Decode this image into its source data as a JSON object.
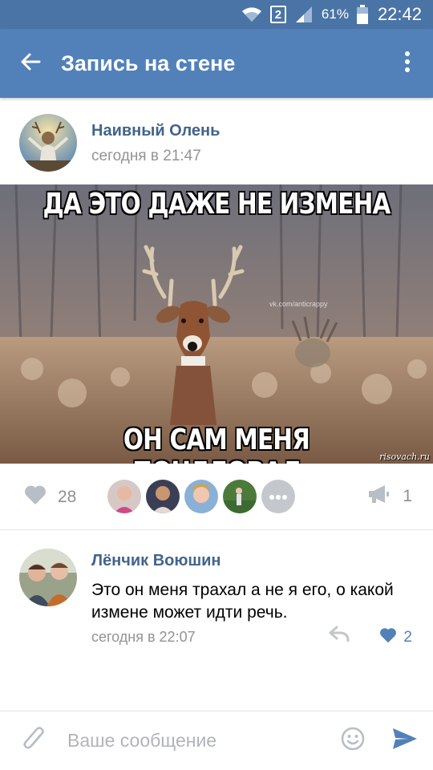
{
  "status_bar": {
    "sim_slot": "2",
    "battery": "61%",
    "time": "22:42",
    "icons": [
      "wifi-icon",
      "sim-icon",
      "signal-icon",
      "battery-icon"
    ]
  },
  "app_bar": {
    "title": "Запись на стене",
    "back_icon": "arrow-left-icon",
    "menu_icon": "more-vertical-icon",
    "color": "#5181b8"
  },
  "post": {
    "author": "Наивный Олень",
    "time": "сегодня в 21:47",
    "image": {
      "top_text": "ДА ЭТО ДАЖЕ НЕ ИЗМЕНА",
      "bottom_text": "ОН САМ МЕНЯ ПОЦЕЛОВАЛ",
      "watermark": "risovach.ru",
      "source_mark": "vk.com/anticrappy"
    },
    "likes": "28",
    "shares": "1",
    "likers_more_icon": "more-horizontal-icon"
  },
  "comment": {
    "author": "Лёнчик Воюшин",
    "text": "Это он меня трахал а не я его, о какой измене может идти речь.",
    "time": "сегодня в 22:07",
    "likes": "2",
    "reply_icon": "reply-icon",
    "like_icon": "heart-icon"
  },
  "composer": {
    "placeholder": "Ваше сообщение",
    "attach_icon": "paperclip-icon",
    "emoji_icon": "smiley-icon",
    "send_icon": "send-icon"
  },
  "colors": {
    "status_bar": "#4a74a5",
    "link": "#42648b",
    "secondary_text": "#939393",
    "accent": "#5181b8"
  }
}
